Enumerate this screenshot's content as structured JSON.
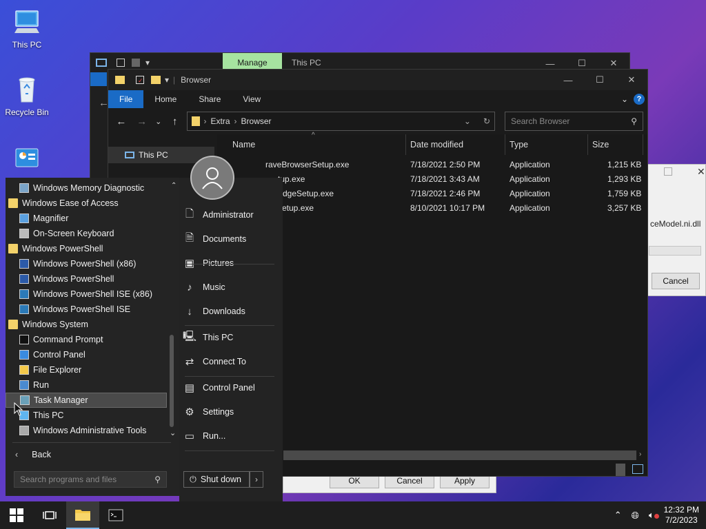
{
  "desktop": {
    "icons": [
      {
        "label": "This PC"
      },
      {
        "label": "Recycle Bin"
      },
      {
        "label": ""
      }
    ]
  },
  "back_window": {
    "manage_tab": "Manage",
    "title": "This PC",
    "controls": {
      "minimize": "—",
      "maximize": "☐",
      "close": "✕"
    }
  },
  "explorer": {
    "title": "Browser",
    "controls": {
      "minimize": "—",
      "maximize": "☐",
      "close": "✕"
    },
    "ribbon_tabs": [
      "File",
      "Home",
      "Share",
      "View"
    ],
    "breadcrumb": [
      "Extra",
      "Browser"
    ],
    "search_placeholder": "Search Browser",
    "sidebar_item": "This PC",
    "columns": [
      "Name",
      "Date modified",
      "Type",
      "Size"
    ],
    "files": [
      {
        "name": "raveBrowserSetup.exe",
        "date": "7/18/2021 2:50 PM",
        "type": "Application",
        "size": "1,215 KB"
      },
      {
        "name": "tup.exe",
        "date": "7/18/2021 3:43 AM",
        "type": "Application",
        "size": "1,293 KB"
      },
      {
        "name": "dgeSetup.exe",
        "date": "7/18/2021 2:46 PM",
        "type": "Application",
        "size": "1,759 KB"
      },
      {
        "name": "etup.exe",
        "date": "8/10/2021 10:17 PM",
        "type": "Application",
        "size": "3,257 KB"
      }
    ]
  },
  "dialog": {
    "buttons": [
      "OK",
      "Cancel",
      "Apply"
    ]
  },
  "right_dialog": {
    "file_text": "ceModel.ni.dll",
    "cancel": "Cancel"
  },
  "start_menu": {
    "programs": [
      {
        "label": "Windows Memory Diagnostic",
        "kind": "app",
        "indent": true
      },
      {
        "label": "Windows Ease of Access",
        "kind": "folder",
        "indent": false
      },
      {
        "label": "Magnifier",
        "kind": "app",
        "indent": true
      },
      {
        "label": "On-Screen Keyboard",
        "kind": "app",
        "indent": true
      },
      {
        "label": "Windows PowerShell",
        "kind": "folder",
        "indent": false
      },
      {
        "label": "Windows PowerShell (x86)",
        "kind": "app",
        "indent": true
      },
      {
        "label": "Windows PowerShell",
        "kind": "app",
        "indent": true
      },
      {
        "label": "Windows PowerShell ISE (x86)",
        "kind": "app",
        "indent": true
      },
      {
        "label": "Windows PowerShell ISE",
        "kind": "app",
        "indent": true
      },
      {
        "label": "Windows System",
        "kind": "folder",
        "indent": false
      },
      {
        "label": "Command Prompt",
        "kind": "app",
        "indent": true
      },
      {
        "label": "Control Panel",
        "kind": "app",
        "indent": true
      },
      {
        "label": "File Explorer",
        "kind": "app",
        "indent": true
      },
      {
        "label": "Run",
        "kind": "app",
        "indent": true
      },
      {
        "label": "Task Manager",
        "kind": "app",
        "indent": true
      },
      {
        "label": "This PC",
        "kind": "app",
        "indent": true
      },
      {
        "label": "Windows Administrative Tools",
        "kind": "app",
        "indent": true
      }
    ],
    "back_label": "Back",
    "search_placeholder": "Search programs and files",
    "right_items": [
      {
        "label": "Administrator",
        "icon": "user-doc-icon"
      },
      {
        "label": "Documents",
        "icon": "document-icon"
      },
      {
        "label": "Pictures",
        "icon": "picture-icon"
      },
      {
        "label": "Music",
        "icon": "music-icon"
      },
      {
        "label": "Downloads",
        "icon": "download-icon"
      },
      {
        "label": "This PC",
        "icon": "computer-icon"
      },
      {
        "label": "Connect To",
        "icon": "connect-icon"
      },
      {
        "label": "Control Panel",
        "icon": "control-panel-icon"
      },
      {
        "label": "Settings",
        "icon": "gear-icon"
      },
      {
        "label": "Run...",
        "icon": "run-icon"
      }
    ],
    "shutdown_label": "Shut down"
  },
  "taskbar": {
    "time": "12:32 PM",
    "date": "7/2/2023"
  }
}
